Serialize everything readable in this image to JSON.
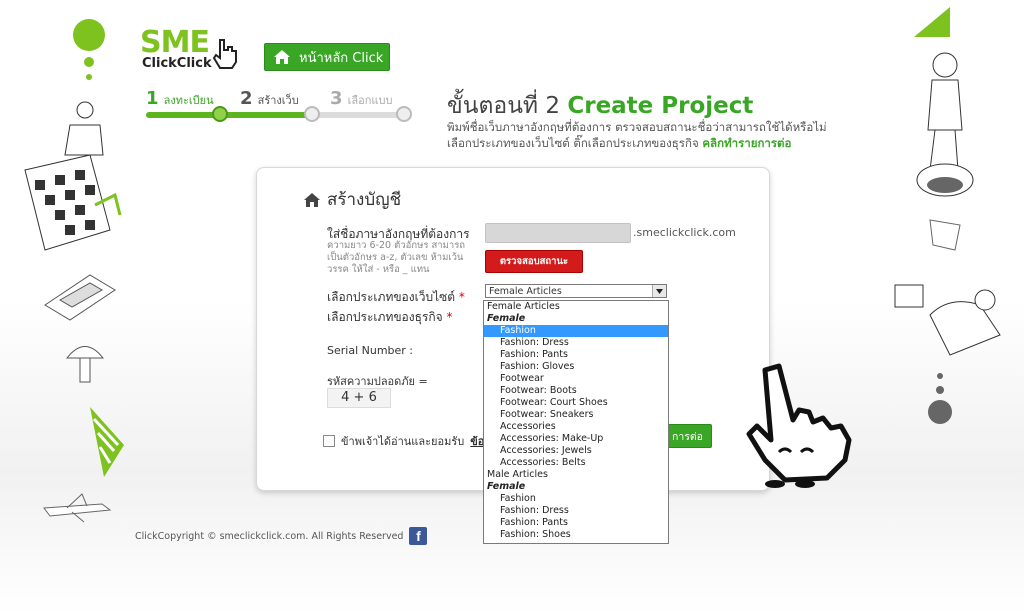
{
  "brand": {
    "logo_top": "SME",
    "logo_bottom": "ClickClick"
  },
  "header": {
    "home_label": "หน้าหลัก Click"
  },
  "steps": [
    {
      "num": "1",
      "label": "ลงทะเบียน"
    },
    {
      "num": "2",
      "label": "สร้างเว็บ"
    },
    {
      "num": "3",
      "label": "เลือกแบบ"
    }
  ],
  "page": {
    "title_prefix": "ขั้นตอนที่ 2",
    "title_en": "Create Project",
    "subtitle_line1": "พิมพ์ชื่อเว็บภาษาอังกฤษที่ต้องการ ตรวจสอบสถานะชื่อว่าสามารถใช้ได้หรือไม่",
    "subtitle_line2": "เลือกประเภทของเว็บไซต์ ติ๊กเลือกประเภทของธุรกิจ",
    "subtitle_link": "คลิกทำรายการต่อ"
  },
  "form": {
    "title": "สร้างบัญชี",
    "domain_label": "ใส่ชื่อภาษาอังกฤษที่ต้องการ",
    "domain_hint": "ความยาว 6-20 ตัวอักษร สามารถเป็นตัวอักษร a-z, ตัวเลข ห้ามเว้นวรรค ให้ใส่ - หรือ _ แทน",
    "domain_value": "",
    "domain_suffix": ".smeclickclick.com",
    "check_button": "ตรวจสอบสถานะ",
    "site_type_label": "เลือกประเภทของเว็บไซต์",
    "business_type_label": "เลือกประเภทของธุรกิจ",
    "required_mark": "*",
    "site_type_value": "Female Articles",
    "serial_label": "Serial Number :",
    "captcha_label": "รหัสความปลอดภัย =",
    "captcha_value": "4 + 6",
    "agree_text": "ข้าพเจ้าได้อ่านและยอมรับ",
    "agree_link": "ข้อต",
    "next_button": "การต่อ"
  },
  "dropdown": {
    "options": [
      {
        "label": "Female Articles",
        "kind": "top"
      },
      {
        "label": "Female",
        "kind": "group"
      },
      {
        "label": "Fashion",
        "kind": "child",
        "selected": true
      },
      {
        "label": "Fashion: Dress",
        "kind": "child"
      },
      {
        "label": "Fashion: Pants",
        "kind": "child"
      },
      {
        "label": "Fashion: Gloves",
        "kind": "child"
      },
      {
        "label": "Footwear",
        "kind": "child"
      },
      {
        "label": "Footwear: Boots",
        "kind": "child"
      },
      {
        "label": "Footwear: Court Shoes",
        "kind": "child"
      },
      {
        "label": "Footwear: Sneakers",
        "kind": "child"
      },
      {
        "label": "Accessories",
        "kind": "child"
      },
      {
        "label": "Accessories: Make-Up",
        "kind": "child"
      },
      {
        "label": "Accessories: Jewels",
        "kind": "child"
      },
      {
        "label": "Accessories: Belts",
        "kind": "child"
      },
      {
        "label": "Male Articles",
        "kind": "top"
      },
      {
        "label": "Female",
        "kind": "group"
      },
      {
        "label": "Fashion",
        "kind": "child"
      },
      {
        "label": "Fashion: Dress",
        "kind": "child"
      },
      {
        "label": "Fashion: Pants",
        "kind": "child"
      },
      {
        "label": "Fashion: Shoes",
        "kind": "child"
      }
    ]
  },
  "footer": {
    "copyright": "ClickCopyright © smeclickclick.com. All Rights Reserved",
    "social": "f"
  },
  "colors": {
    "accent": "#3aa626",
    "danger": "#d41b1b",
    "select_highlight": "#3399ff"
  }
}
